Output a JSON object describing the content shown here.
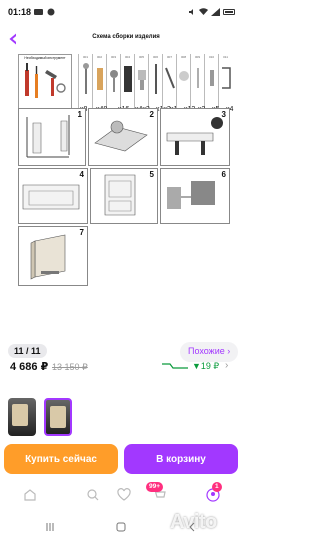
{
  "status_bar": {
    "time": "01:18"
  },
  "gallery": {
    "title": "Схема сборки изделия",
    "tools_label": "Необходимый инструмент",
    "part_codes": [
      "001",
      "002",
      "003",
      "004",
      "005",
      "006",
      "007",
      "008",
      "009",
      "010",
      "011"
    ],
    "part_qty": [
      "x8",
      "x48",
      "x16",
      "x4x2",
      "x1x2",
      "x1",
      "x12",
      "x2",
      "x5",
      "x4"
    ],
    "steps": [
      "1",
      "2",
      "3",
      "4",
      "5",
      "6",
      "7"
    ],
    "page_counter": "11 / 11",
    "similar_label": "Похожие ›"
  },
  "pricing": {
    "price": "4 686 ₽",
    "old_price": "13 150 ₽",
    "trend": "▼19 ₽",
    "colors": {
      "accent": "#a238ff",
      "buy": "#ff9d29",
      "trend": "#0a9b3c"
    }
  },
  "cta": {
    "buy_label": "Купить сейчас",
    "cart_label": "В корзину"
  },
  "tab_bar": {
    "items": [
      "home-icon",
      "search-catalog-icon",
      "favorites-icon",
      "cart-icon",
      "profile-icon"
    ],
    "cart_badge": "99+",
    "profile_badge": "1"
  }
}
